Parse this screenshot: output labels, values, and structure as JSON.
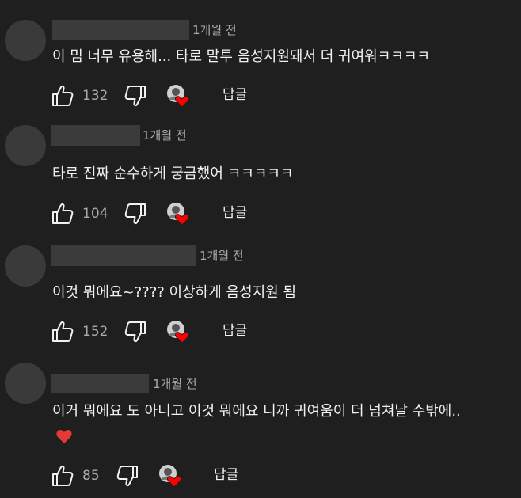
{
  "comments": [
    {
      "time": "1개월 전",
      "text": "이 밈 너무 유용해... 타로 말투 음성지원돼서 더 귀여워ㅋㅋㅋㅋ",
      "likes": "132",
      "reply_label": "답글"
    },
    {
      "time": "1개월 전",
      "text": "타로 진짜 순수하게 궁금했어 ㅋㅋㅋㅋㅋ",
      "likes": "104",
      "reply_label": "답글"
    },
    {
      "time": "1개월 전",
      "text": "이것 뭐에요~???? 이상하게 음성지원 됨",
      "likes": "152",
      "reply_label": "답글"
    },
    {
      "time": "1개월 전",
      "text": "이거 뭐에요 도 아니고 이것 뭐에요 니까 귀여움이 더 넘쳐날 수밖에..",
      "likes": "85",
      "reply_label": "답글"
    }
  ],
  "colors": {
    "background": "#1f1f1f",
    "text": "#f1f1f1",
    "secondary": "#aaaaaa",
    "heart": "#ff0000"
  }
}
